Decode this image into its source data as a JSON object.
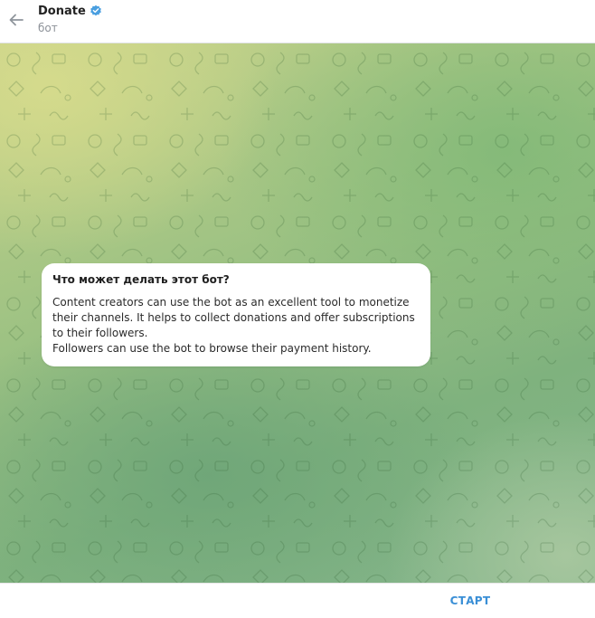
{
  "header": {
    "title": "Donate",
    "subtitle": "бот"
  },
  "bot_info": {
    "heading": "Что может делать этот бот?",
    "lines": [
      "Content creators can use the bot as  an excellent tool to monetize",
      "their channels. It helps to collect donations and offer subscriptions",
      "to their followers.",
      "Followers can use the bot to browse their payment history."
    ]
  },
  "footer": {
    "start_label": "СТАРТ"
  },
  "colors": {
    "accent": "#3a8fd6",
    "verified_badge": "#4a9fe0",
    "background_light": "#c7d38a",
    "background_dark": "#7fb27e"
  },
  "icons": {
    "back": "arrow-left-icon",
    "verified": "verified-badge-icon"
  }
}
